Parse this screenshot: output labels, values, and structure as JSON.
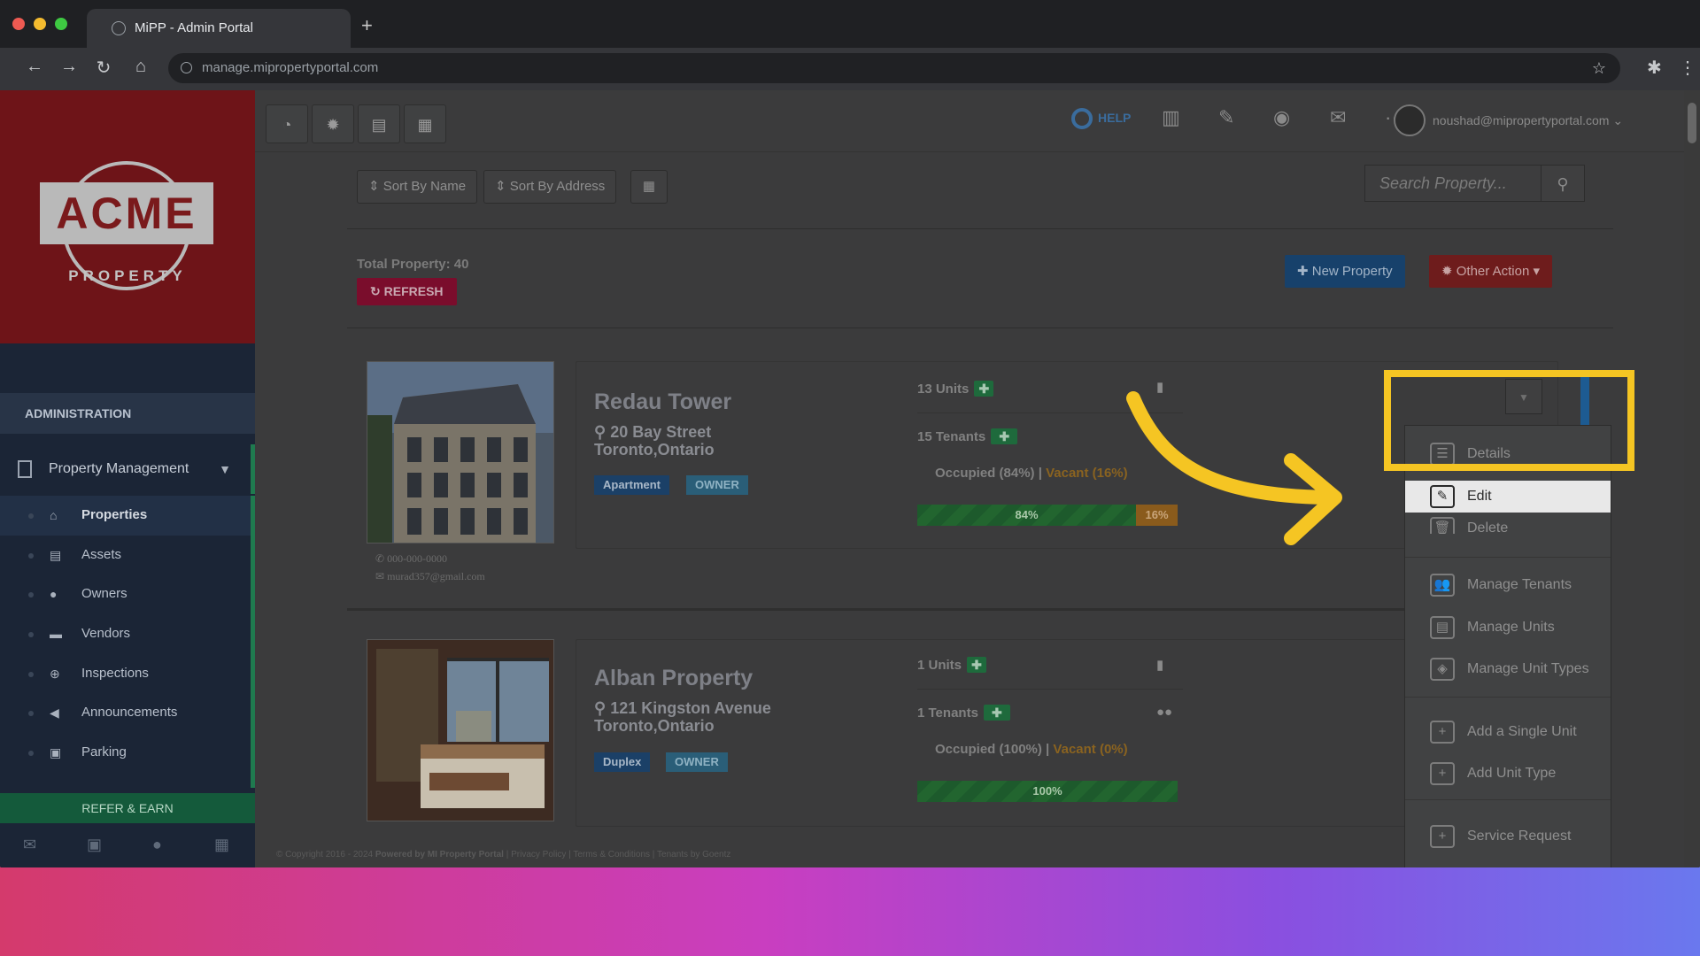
{
  "browser": {
    "tab_title": "MiPP - Admin Portal",
    "new_tab": "+",
    "url": "manage.mipropertyportal.com"
  },
  "sidebar": {
    "logo_text": "ACME",
    "logo_sub": "PROPERTY",
    "section": "ADMINISTRATION",
    "group": "Property Management",
    "items": [
      {
        "label": "Properties",
        "icon": "home-icon"
      },
      {
        "label": "Assets",
        "icon": "archive-icon"
      },
      {
        "label": "Owners",
        "icon": "user-icon"
      },
      {
        "label": "Vendors",
        "icon": "briefcase-icon"
      },
      {
        "label": "Inspections",
        "icon": "zoom-icon"
      },
      {
        "label": "Announcements",
        "icon": "bullhorn-icon"
      },
      {
        "label": "Parking",
        "icon": "car-icon"
      }
    ],
    "refer": "REFER & EARN"
  },
  "topbar": {
    "help": "HELP",
    "user_email": "noushad@mipropertyportal.com"
  },
  "toolbar": {
    "sort_name": "Sort By Name",
    "sort_address": "Sort By Address",
    "search_placeholder": "Search Property..."
  },
  "summary": {
    "total": "Total Property: 40",
    "refresh": "REFRESH",
    "new_property": "New Property",
    "other_action": "Other Action"
  },
  "properties": [
    {
      "name": "Redau Tower",
      "address1": "20 Bay Street",
      "address2": "Toronto,Ontario",
      "type": "Apartment",
      "role": "OWNER",
      "units": "13 Units",
      "tenants": "15 Tenants",
      "occupied": "Occupied (84%)",
      "vacant": "Vacant (16%)",
      "occupied_pct": 84,
      "vacant_pct": 16,
      "bar_occ_label": "84%",
      "bar_vac_label": "16%",
      "phone": "000-000-0000",
      "email": "murad357@gmail.com"
    },
    {
      "name": "Alban Property",
      "address1": "121 Kingston Avenue",
      "address2": "Toronto,Ontario",
      "type": "Duplex",
      "role": "OWNER",
      "units": "1 Units",
      "tenants": "1 Tenants",
      "occupied": "Occupied (100%)",
      "vacant": "Vacant (0%)",
      "occupied_pct": 100,
      "vacant_pct": 0,
      "bar_occ_label": "100%"
    }
  ],
  "dropdown": {
    "details": "Details",
    "edit": "Edit",
    "delete": "Delete",
    "manage_tenants": "Manage Tenants",
    "manage_units": "Manage Units",
    "manage_unit_types": "Manage Unit Types",
    "add_single_unit": "Add a Single Unit",
    "add_unit_type": "Add Unit Type",
    "service_request": "Service Request"
  },
  "footer": {
    "copyright": "© Copyright 2016 - 2024",
    "powered": "Powered by MI Property Portal",
    "privacy": "Privacy Policy",
    "terms": "Terms & Conditions",
    "tenants_by": "Tenants by Goentz"
  },
  "colors": {
    "highlight": "#f5c523",
    "arrow": "#f5c523",
    "brand_red": "#6e1418"
  }
}
